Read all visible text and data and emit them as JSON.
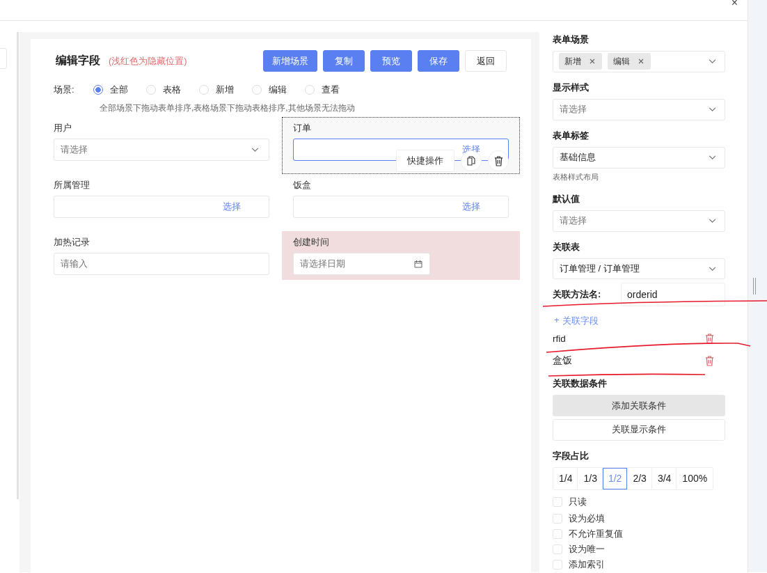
{
  "dialog": {
    "close": "×"
  },
  "editor": {
    "title": "编辑字段",
    "note": "(浅红色为隐藏位置)",
    "buttons": [
      {
        "label": "新增场景",
        "kind": "primary"
      },
      {
        "label": "复制",
        "kind": "primary"
      },
      {
        "label": "预览",
        "kind": "primary"
      },
      {
        "label": "保存",
        "kind": "primary"
      },
      {
        "label": "返回",
        "kind": "plain"
      }
    ],
    "scene": {
      "label": "场景:",
      "options": [
        {
          "label": "全部",
          "selected": true
        },
        {
          "label": "表格",
          "selected": false
        },
        {
          "label": "新增",
          "selected": false
        },
        {
          "label": "编辑",
          "selected": false
        },
        {
          "label": "查看",
          "selected": false
        }
      ],
      "hint": "全部场景下拖动表单排序,表格场景下拖动表格排序,其他场景无法拖动"
    },
    "fields": [
      {
        "label": "用户",
        "kind": "select",
        "placeholder": "请选择",
        "selected": false,
        "hidden": false
      },
      {
        "label": "订单",
        "kind": "picker",
        "action": "选择",
        "selected": true,
        "hidden": false
      },
      {
        "label": "所属管理",
        "kind": "picker",
        "action": "选择",
        "selected": false,
        "hidden": false
      },
      {
        "label": "饭盒",
        "kind": "picker",
        "action": "选择",
        "selected": false,
        "hidden": false
      },
      {
        "label": "加热记录",
        "kind": "input",
        "placeholder": "请输入",
        "selected": false,
        "hidden": false
      },
      {
        "label": "创建时间",
        "kind": "date",
        "placeholder": "请选择日期",
        "selected": false,
        "hidden": true
      }
    ],
    "quick_action": "快捷操作"
  },
  "settings": {
    "form_scene": {
      "label": "表单场景",
      "tags": [
        "新增",
        "编辑"
      ]
    },
    "display_style": {
      "label": "显示样式",
      "placeholder": "请选择"
    },
    "form_tab": {
      "label": "表单标签",
      "value": "基础信息",
      "hint": "表格样式布局"
    },
    "default_value": {
      "label": "默认值",
      "placeholder": "请选择"
    },
    "related_table": {
      "label": "关联表",
      "value": "订单管理 / 订单管理"
    },
    "method": {
      "label": "关联方法名:",
      "value": "orderid"
    },
    "add_field": {
      "icon": "+",
      "label": "关联字段"
    },
    "related_fields": [
      "rfid",
      "盒饭"
    ],
    "conditions": {
      "label": "关联数据条件",
      "buttons": [
        {
          "label": "添加关联条件",
          "kind": "filled"
        },
        {
          "label": "关联显示条件",
          "kind": "plain"
        }
      ]
    },
    "ratio": {
      "label": "字段占比",
      "options": [
        {
          "label": "1/4",
          "selected": false
        },
        {
          "label": "1/3",
          "selected": false
        },
        {
          "label": "1/2",
          "selected": true
        },
        {
          "label": "2/3",
          "selected": false
        },
        {
          "label": "3/4",
          "selected": false
        },
        {
          "label": "100%",
          "selected": false
        }
      ]
    },
    "checks": [
      {
        "label": "只读",
        "checked": false
      },
      {
        "label": "设为必填",
        "checked": false
      },
      {
        "label": "不允许重复值",
        "checked": false
      },
      {
        "label": "设为唯一",
        "checked": false
      },
      {
        "label": "添加索引",
        "checked": false
      }
    ]
  }
}
